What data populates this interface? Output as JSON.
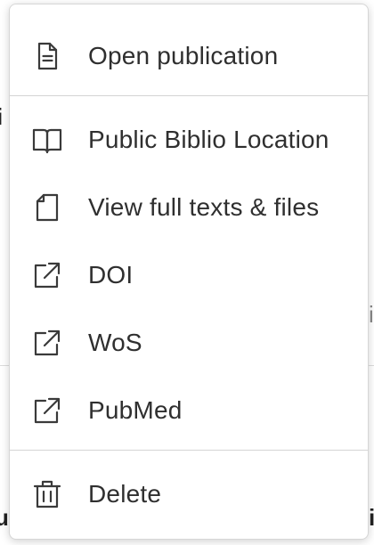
{
  "background": {
    "fragments": [
      "i",
      "i",
      "u",
      "i"
    ]
  },
  "menu": {
    "items": [
      {
        "label": "Open publication",
        "icon": "document-icon"
      },
      {
        "label": "Public Biblio Location",
        "icon": "open-book-icon"
      },
      {
        "label": "View full texts & files",
        "icon": "file-icon"
      },
      {
        "label": "DOI",
        "icon": "external-link-icon"
      },
      {
        "label": "WoS",
        "icon": "external-link-icon"
      },
      {
        "label": "PubMed",
        "icon": "external-link-icon"
      },
      {
        "label": "Delete",
        "icon": "trash-icon"
      }
    ]
  },
  "colors": {
    "text": "#2f2f2f",
    "icon": "#3a3a3a",
    "divider": "#d4d4d4",
    "background": "#ffffff"
  }
}
